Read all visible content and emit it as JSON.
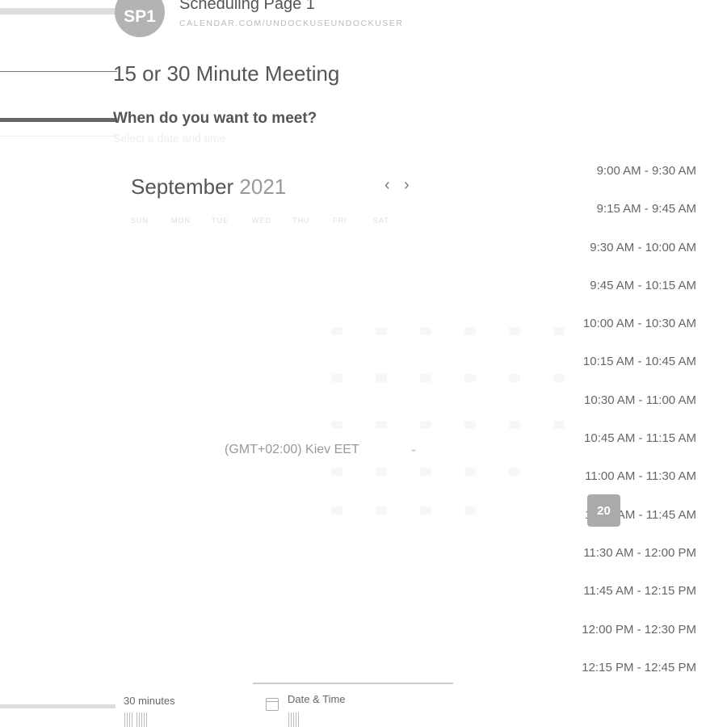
{
  "header": {
    "avatar_initials": "SP1",
    "page_name": "Scheduling Page 1",
    "page_url": "CALENDAR.COM/UNDOCKUSEUNDOCKUSER"
  },
  "event": {
    "title": "15 or 30 Minute Meeting",
    "question": "When do you want to meet?",
    "subtitle": "Select a date and time"
  },
  "calendar": {
    "month": "September",
    "year": "2021",
    "weekdays": [
      "SUN",
      "MON",
      "TUE",
      "WED",
      "THU",
      "FRI",
      "SAT"
    ],
    "selected_day": "20"
  },
  "timezone": {
    "label": "(GMT+02:00) Kiev EET",
    "caret": "⌄"
  },
  "time_slots": [
    "9:00 AM - 9:30 AM",
    "9:15 AM - 9:45 AM",
    "9:30 AM - 10:00 AM",
    "9:45 AM - 10:15 AM",
    "10:00 AM - 10:30 AM",
    "10:15 AM - 10:45 AM",
    "10:30 AM - 11:00 AM",
    "10:45 AM - 11:15 AM",
    "11:00 AM - 11:30 AM",
    "11:15 AM - 11:45 AM",
    "11:30 AM - 12:00 PM",
    "11:45 AM - 12:15 PM",
    "12:00 PM - 12:30 PM",
    "12:15 PM - 12:45 PM"
  ],
  "footer": {
    "duration_label": "30 minutes",
    "datetime_label": "Date & Time"
  },
  "icons": {
    "prev": "chevron-left-icon",
    "next": "chevron-right-icon",
    "calendar": "calendar-icon"
  }
}
